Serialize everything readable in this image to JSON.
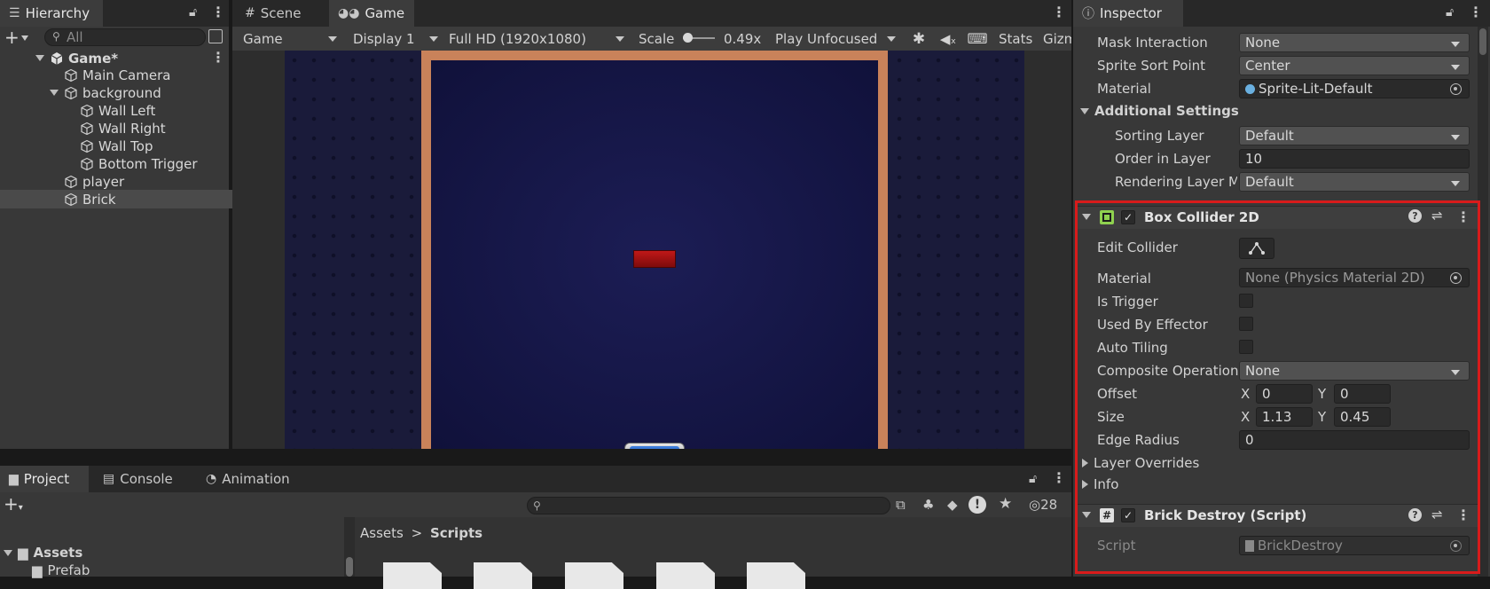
{
  "hierarchy": {
    "title": "Hierarchy",
    "search_placeholder": "All",
    "root": "Game*",
    "items": [
      {
        "label": "Main Camera"
      },
      {
        "label": "background"
      },
      {
        "label": "Wall Left"
      },
      {
        "label": "Wall Right"
      },
      {
        "label": "Wall Top"
      },
      {
        "label": "Bottom Trigger"
      },
      {
        "label": "player"
      },
      {
        "label": "Brick"
      }
    ]
  },
  "center_tabs": {
    "scene": "Scene",
    "game": "Game"
  },
  "game_toolbar": {
    "mode": "Game",
    "display": "Display 1",
    "resolution": "Full HD (1920x1080)",
    "scale_label": "Scale",
    "scale_value": "0.49x",
    "play_mode": "Play Unfocused",
    "stats": "Stats",
    "gizmos": "Gizm"
  },
  "bottom_tabs": {
    "project": "Project",
    "console": "Console",
    "animation": "Animation"
  },
  "project": {
    "count": "28",
    "root_label": "Assets",
    "prefab_label": "Prefab",
    "breadcrumb_root": "Assets",
    "breadcrumb_sep": ">",
    "breadcrumb_current": "Scripts"
  },
  "inspector": {
    "title": "Inspector",
    "top": {
      "mask_interaction_label": "Mask Interaction",
      "mask_interaction_value": "None",
      "sprite_sort_label": "Sprite Sort Point",
      "sprite_sort_value": "Center",
      "material_label": "Material",
      "material_value": "Sprite-Lit-Default",
      "additional_settings": "Additional Settings",
      "sorting_layer_label": "Sorting Layer",
      "sorting_layer_value": "Default",
      "order_label": "Order in Layer",
      "order_value": "10",
      "rendering_label": "Rendering Layer M",
      "rendering_value": "Default"
    },
    "box_collider": {
      "title": "Box Collider 2D",
      "edit_collider": "Edit Collider",
      "material_label": "Material",
      "material_value": "None (Physics Material 2D)",
      "is_trigger": "Is Trigger",
      "used_by_effector": "Used By Effector",
      "auto_tiling": "Auto Tiling",
      "composite_label": "Composite Operation",
      "composite_value": "None",
      "offset_label": "Offset",
      "offset_x": "0",
      "offset_y": "0",
      "size_label": "Size",
      "size_x": "1.13",
      "size_y": "0.45",
      "x_label": "X",
      "y_label": "Y",
      "edge_radius_label": "Edge Radius",
      "edge_radius_value": "0",
      "layer_overrides": "Layer Overrides",
      "info": "Info"
    },
    "brick_destroy": {
      "title": "Brick Destroy (Script)",
      "script_label": "Script",
      "script_value": "BrickDestroy"
    }
  },
  "colors": {
    "highlight": "#d81b1b",
    "brick": "#8e0d0d",
    "frame": "#c9825a",
    "paddle": "#3a7ad8"
  }
}
